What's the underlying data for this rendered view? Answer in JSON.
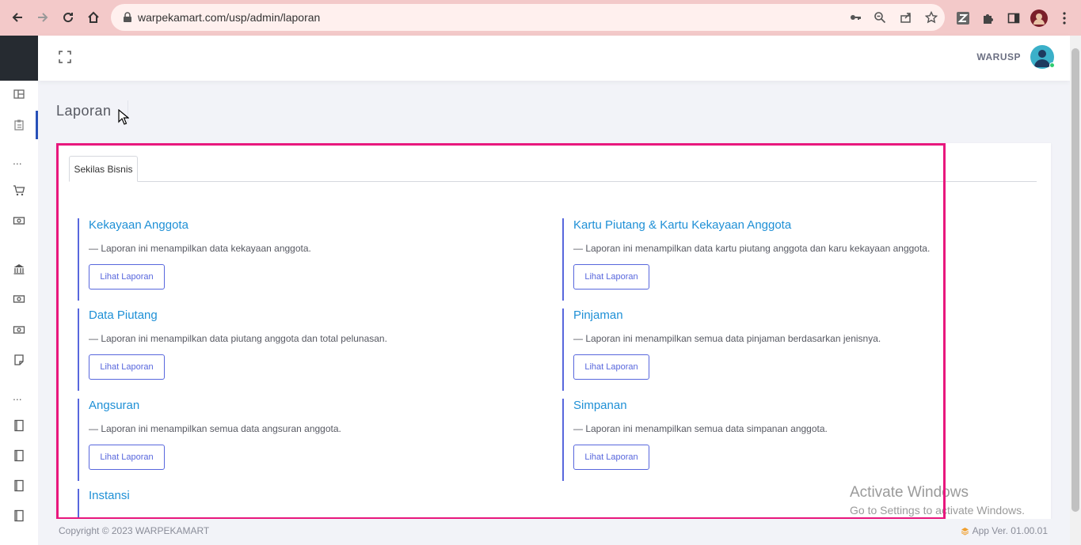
{
  "browser": {
    "url": "warpekamart.com/usp/admin/laporan"
  },
  "header": {
    "username": "WARUSP"
  },
  "page": {
    "title": "Laporan"
  },
  "tabs": [
    {
      "label": "Sekilas Bisnis"
    }
  ],
  "reports": [
    {
      "title": "Kekayaan Anggota",
      "desc": "— Laporan ini menampilkan data kekayaan anggota.",
      "button": "Lihat Laporan"
    },
    {
      "title": "Kartu Piutang & Kartu Kekayaan Anggota",
      "desc": "— Laporan ini menampilkan data kartu piutang anggota dan karu kekayaan anggota.",
      "button": "Lihat Laporan"
    },
    {
      "title": "Data Piutang",
      "desc": "— Laporan ini menampilkan data piutang anggota dan total pelunasan.",
      "button": "Lihat Laporan"
    },
    {
      "title": "Pinjaman",
      "desc": "— Laporan ini menampilkan semua data pinjaman berdasarkan jenisnya.",
      "button": "Lihat Laporan"
    },
    {
      "title": "Angsuran",
      "desc": "— Laporan ini menampilkan semua data angsuran anggota.",
      "button": "Lihat Laporan"
    },
    {
      "title": "Simpanan",
      "desc": "— Laporan ini menampilkan semua data simpanan anggota.",
      "button": "Lihat Laporan"
    },
    {
      "title": "Instansi"
    }
  ],
  "watermark": {
    "line1": "Activate Windows",
    "line2": "Go to Settings to activate Windows."
  },
  "footer": {
    "copyright": "Copyright © 2023 WARPEKAMART",
    "version": "App Ver. 01.00.01"
  },
  "colors": {
    "accent": "#5867dd",
    "link": "#1f90d6",
    "highlight": "#e8177d",
    "sidebar_brand": "#262b31"
  }
}
